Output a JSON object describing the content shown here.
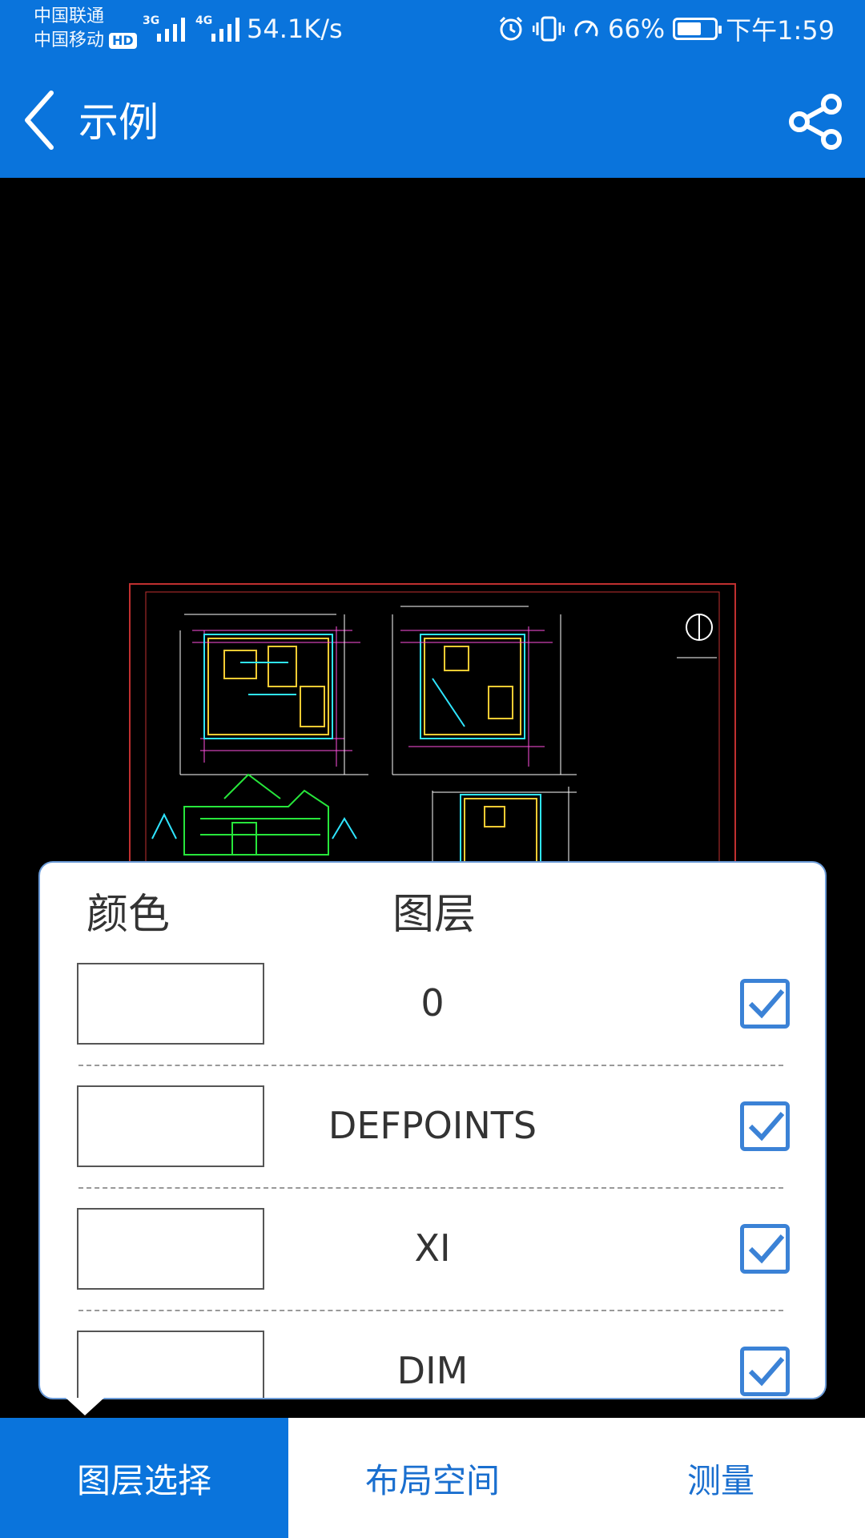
{
  "status_bar": {
    "carrier_1": "中国联通",
    "carrier_2": "中国移动",
    "hd_badge": "HD",
    "net_1": "3G",
    "net_2": "4G",
    "net_speed": "54.1K/s",
    "battery_percent": "66%",
    "battery_level": 0.66,
    "time": "下午1:59"
  },
  "app_bar": {
    "title": "示例",
    "back_icon": "chevron-left-icon",
    "share_icon": "share-icon"
  },
  "layer_panel": {
    "header_color": "颜色",
    "header_layer": "图层",
    "layers": [
      {
        "name": "0",
        "checked": true,
        "color": "#ffffff"
      },
      {
        "name": "DEFPOINTS",
        "checked": true,
        "color": "#ffffff"
      },
      {
        "name": "XI",
        "checked": true,
        "color": "#ffffff"
      },
      {
        "name": "DIM",
        "checked": true,
        "color": "#ffffff"
      }
    ]
  },
  "bottom_nav": {
    "tabs": [
      {
        "label": "图层选择",
        "active": true
      },
      {
        "label": "布局空间",
        "active": false
      },
      {
        "label": "测量",
        "active": false
      }
    ]
  },
  "colors": {
    "primary": "#0a74dc",
    "checkbox": "#3b82d6",
    "canvas_bg": "#000000"
  }
}
